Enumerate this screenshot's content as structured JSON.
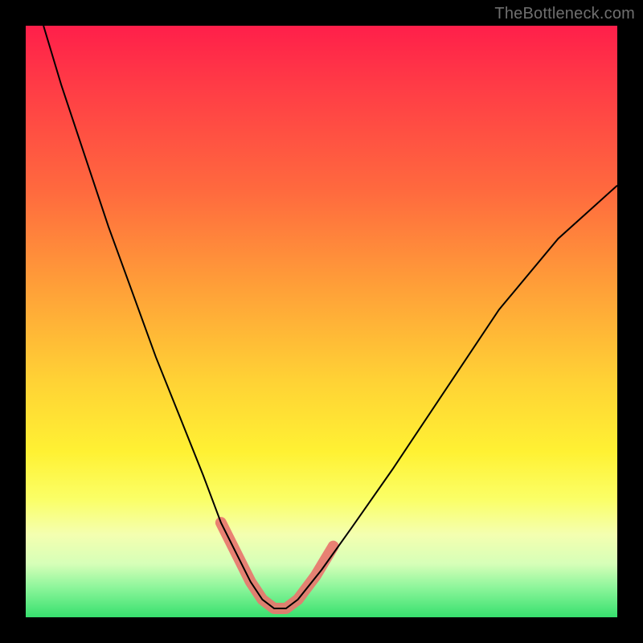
{
  "watermark": {
    "text": "TheBottleneck.com"
  },
  "chart_data": {
    "type": "line",
    "title": "",
    "xlabel": "",
    "ylabel": "",
    "xlim": [
      0,
      100
    ],
    "ylim": [
      0,
      100
    ],
    "grid": false,
    "legend": false,
    "series": [
      {
        "name": "bottleneck-curve",
        "x": [
          3,
          6,
          10,
          14,
          18,
          22,
          26,
          30,
          33,
          36,
          38,
          40,
          42,
          44,
          46,
          50,
          55,
          62,
          70,
          80,
          90,
          100
        ],
        "y": [
          100,
          90,
          78,
          66,
          55,
          44,
          34,
          24,
          16,
          10,
          6,
          3,
          1.5,
          1.5,
          3,
          8,
          15,
          25,
          37,
          52,
          64,
          73
        ],
        "color": "#000000"
      }
    ],
    "highlight": {
      "name": "optimal-range",
      "color": "#e8766e",
      "x": [
        33,
        36,
        38,
        40,
        42,
        44,
        46,
        49,
        52
      ],
      "y": [
        16,
        10,
        6,
        3,
        1.5,
        1.5,
        3,
        7,
        12
      ]
    },
    "gradient_scale": {
      "orientation": "vertical",
      "meaning": "severity (top=bad, bottom=good)",
      "stops": [
        {
          "pos": 0.0,
          "color": "#ff1f4a"
        },
        {
          "pos": 0.28,
          "color": "#ff6a3e"
        },
        {
          "pos": 0.6,
          "color": "#ffd235"
        },
        {
          "pos": 0.8,
          "color": "#fbff66"
        },
        {
          "pos": 1.0,
          "color": "#37e06e"
        }
      ]
    }
  }
}
